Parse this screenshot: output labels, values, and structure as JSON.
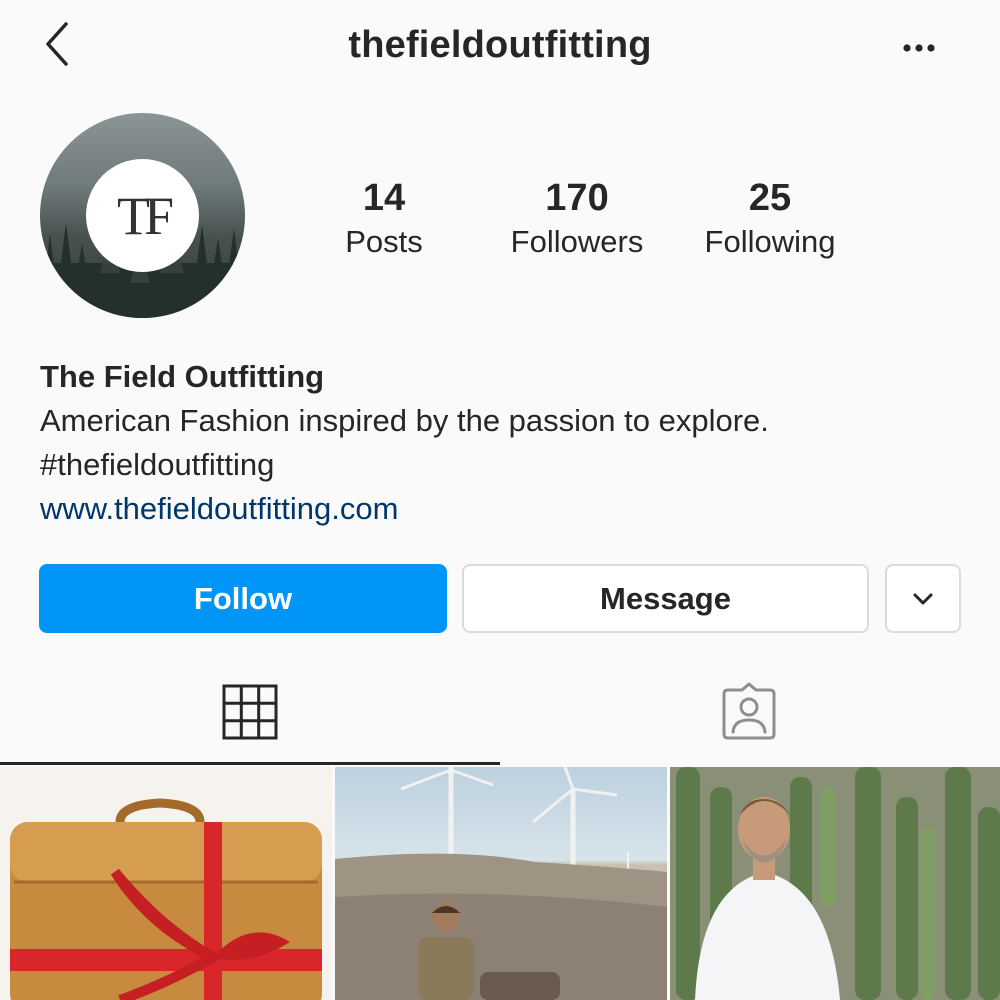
{
  "header": {
    "username": "thefieldoutfitting",
    "back_icon": "chevron-left-icon",
    "more_icon": "ellipsis-icon"
  },
  "profile": {
    "avatar_logo": "TF",
    "stats": {
      "posts": {
        "count": "14",
        "label": "Posts"
      },
      "followers": {
        "count": "170",
        "label": "Followers"
      },
      "following": {
        "count": "25",
        "label": "Following"
      }
    },
    "display_name": "The Field Outfitting",
    "bio_line": "American Fashion inspired by the passion to explore.",
    "hashtag": "#thefieldoutfitting",
    "website": "www.thefieldoutfitting.com"
  },
  "actions": {
    "follow_label": "Follow",
    "message_label": "Message",
    "more_icon": "chevron-down-icon"
  },
  "tabs": {
    "grid_icon": "grid-icon",
    "tagged_icon": "tagged-person-icon",
    "active": "grid"
  },
  "colors": {
    "follow_button": "#0095f6",
    "link": "#00376b",
    "text": "#262626",
    "background": "#fafafa"
  }
}
